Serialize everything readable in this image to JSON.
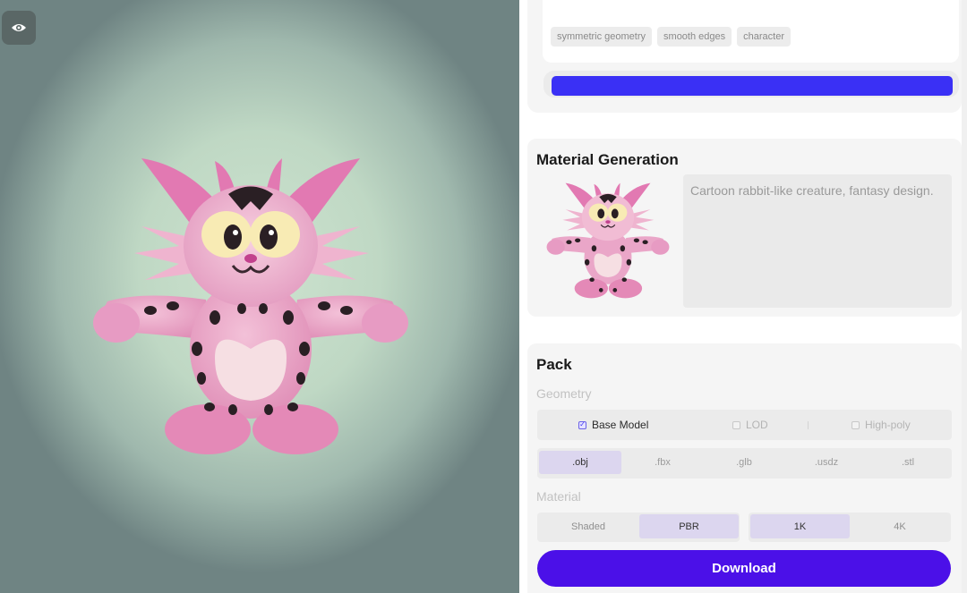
{
  "viewport": {
    "toggle_icon": "eye-icon",
    "background_center": "#cde3cf",
    "background_edge": "#6f8483"
  },
  "prompt": {
    "tags": [
      "symmetric geometry",
      "smooth edges",
      "character"
    ],
    "progress_color": "#3a30f5",
    "progress": 1.0
  },
  "material_generation": {
    "title": "Material Generation",
    "description": "Cartoon rabbit-like creature, fantasy design."
  },
  "pack": {
    "title": "Pack",
    "geometry_label": "Geometry",
    "geometry_options": [
      {
        "label": "Base Model",
        "checked": true
      },
      {
        "label": "LOD",
        "checked": false
      },
      {
        "label": "High-poly",
        "checked": false
      }
    ],
    "formats": [
      ".obj",
      ".fbx",
      ".glb",
      ".usdz",
      ".stl"
    ],
    "selected_format": ".obj",
    "material_label": "Material",
    "shading_options": [
      "Shaded",
      "PBR"
    ],
    "selected_shading": "PBR",
    "resolution_options": [
      "1K",
      "4K"
    ],
    "selected_resolution": "1K",
    "download_label": "Download"
  },
  "colors": {
    "accent": "#4b10e8",
    "selection": "#dcd6ef",
    "model_pink": "#e88fbe",
    "model_spots": "#2a1f24"
  }
}
